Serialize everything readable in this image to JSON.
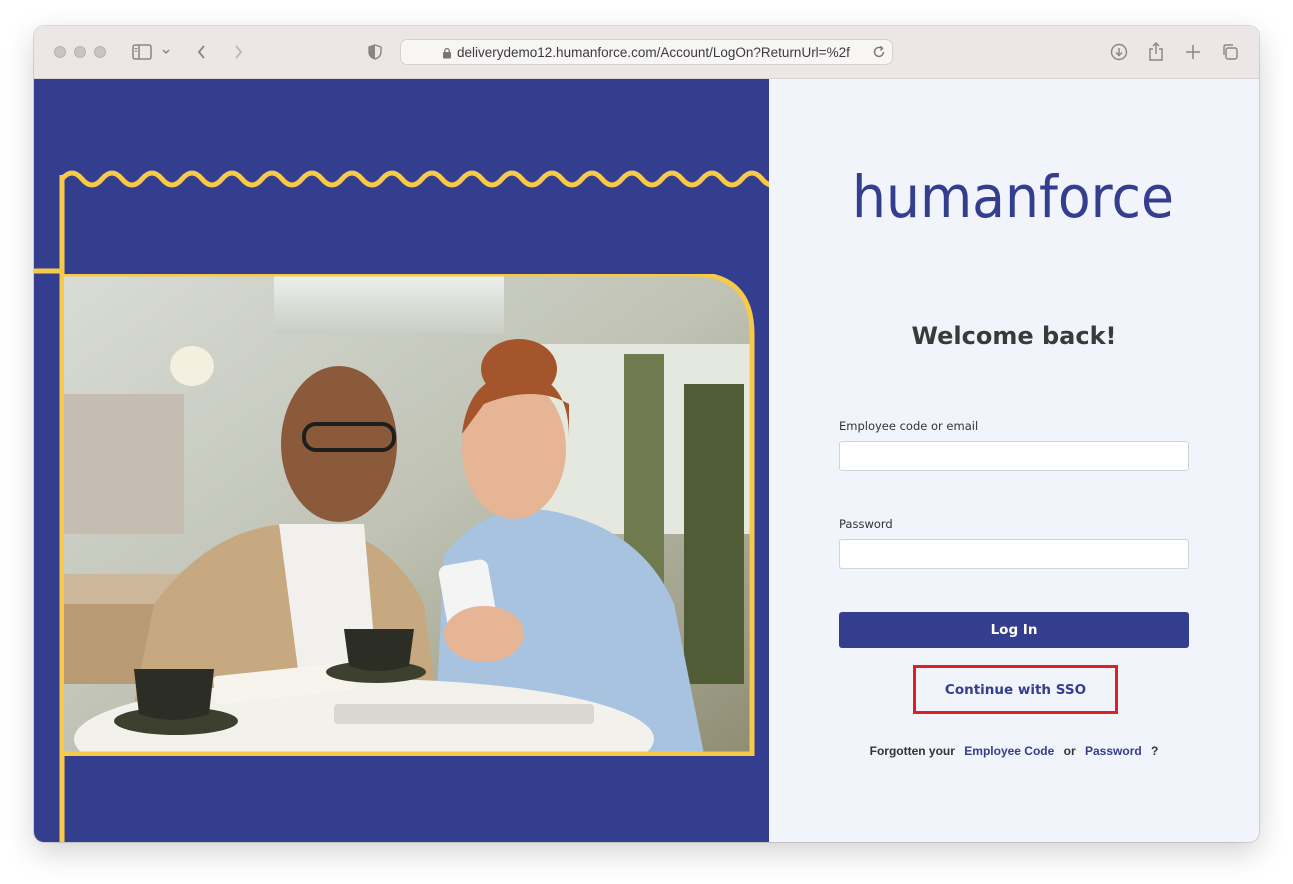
{
  "browser": {
    "url": "deliverydemo12.humanforce.com/Account/LogOn?ReturnUrl=%2f"
  },
  "brand": {
    "logo_text": "humanforce",
    "primary_color": "#343e8e",
    "accent_color": "#f7c948"
  },
  "login": {
    "heading": "Welcome back!",
    "employee_label": "Employee code or email",
    "employee_value": "",
    "password_label": "Password",
    "password_value": "",
    "login_button": "Log In",
    "sso_button": "Continue with SSO",
    "forgot_prefix": "Forgotten your",
    "forgot_code_link": "Employee Code",
    "forgot_or": "or",
    "forgot_password_link": "Password",
    "forgot_suffix": "?"
  },
  "icons": {
    "sidebar": "sidebar-icon",
    "back": "chevron-left-icon",
    "forward": "chevron-right-icon",
    "shield": "shield-icon",
    "lock": "lock-icon",
    "reload": "reload-icon",
    "download": "download-icon",
    "share": "share-icon",
    "new_tab": "plus-icon",
    "tabs": "tabs-overview-icon"
  }
}
